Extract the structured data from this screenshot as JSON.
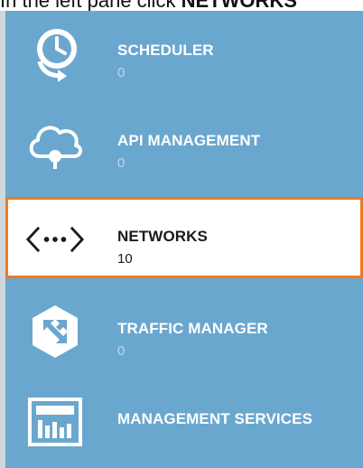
{
  "caption": {
    "prefix": "In the left pane click ",
    "emphasis": "NETWORKS"
  },
  "sidebar": {
    "items": [
      {
        "label": "SCHEDULER",
        "count": "0",
        "icon": "scheduler-clock-icon"
      },
      {
        "label": "API MANAGEMENT",
        "count": "0",
        "icon": "api-cloud-icon"
      },
      {
        "label": "NETWORKS",
        "count": "10",
        "icon": "networks-icon",
        "selected": true
      },
      {
        "label": "TRAFFIC MANAGER",
        "count": "0",
        "icon": "traffic-manager-icon"
      },
      {
        "label": "MANAGEMENT SERVICES",
        "count": "",
        "icon": "management-services-icon"
      }
    ]
  },
  "colors": {
    "pane_background": "#6aa7cf",
    "selection_border": "#ee7a20",
    "selected_background": "#ffffff",
    "muted_count": "#b9d8ec"
  }
}
